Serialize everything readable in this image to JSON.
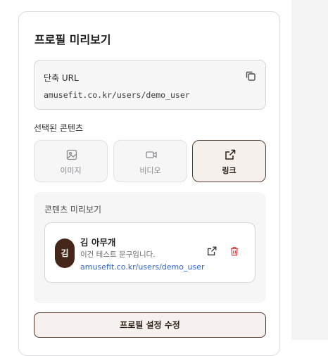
{
  "profile_preview": {
    "title": "프로필 미리보기",
    "short_url": {
      "label": "단축 URL",
      "value": "amusefit.co.kr/users/demo_user",
      "copy_icon": "copy-icon"
    },
    "selected_content": {
      "label": "선택된 콘텐츠",
      "options": [
        {
          "label": "이미지",
          "icon": "image-icon",
          "active": false
        },
        {
          "label": "비디오",
          "icon": "video-icon",
          "active": false
        },
        {
          "label": "링크",
          "icon": "external-link-icon",
          "active": true
        }
      ]
    },
    "content_preview": {
      "label": "콘텐츠 미리보기",
      "card": {
        "avatar_text": "김",
        "name": "김 아무개",
        "description": "이건 테스트 문구입니다.",
        "link": "amusefit.co.kr/users/demo_user",
        "open_icon": "external-link-icon",
        "delete_icon": "trash-icon"
      }
    },
    "edit_button_label": "프로필 설정 수정"
  },
  "colors": {
    "accent_dark_brown": "#45271a",
    "link_blue": "#2b64c7",
    "delete_red": "#d9434b"
  }
}
